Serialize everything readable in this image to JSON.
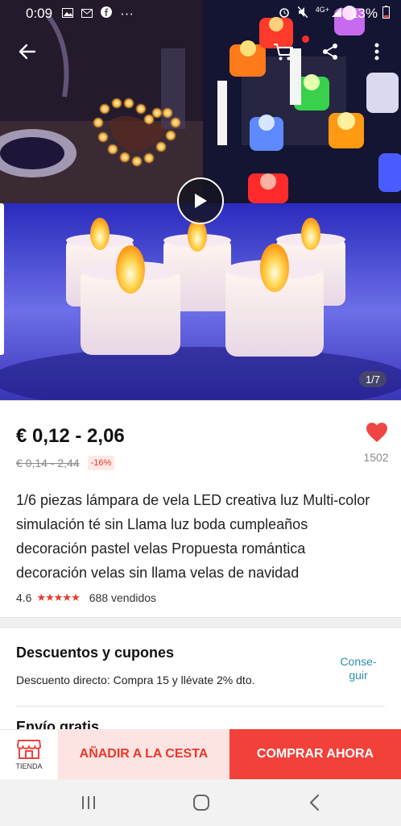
{
  "status_bar": {
    "time": "0:09",
    "notif_icons": [
      "gallery-icon",
      "gmail-icon",
      "facebook-icon"
    ],
    "more_notifs": "···",
    "network": "4G+",
    "battery": "13%"
  },
  "gallery": {
    "counter": "1/7",
    "has_video": true
  },
  "product": {
    "price": "€ 0,12 - 2,06",
    "old_price": "€ 0,14 - 2,44",
    "discount": "-16%",
    "favorites": "1502",
    "title": "1/6 piezas lámpara de vela LED creativa luz Multi-color simulación té sin Llama luz boda cumpleaños decoración pastel velas Propuesta romántica decoración velas sin llama velas de navidad",
    "rating": "4.6",
    "stars_display": "★★★★★",
    "sold": "688 vendidos"
  },
  "discounts": {
    "title": "Descuentos y cupones",
    "text": "Descuento directo: Compra 15 y llévate 2% dto.",
    "link_line1": "Conse-",
    "link_line2": "guir",
    "next_section": "Envío gratis"
  },
  "actions": {
    "store_label": "TIENDA",
    "add_to_cart": "AÑADIR A LA CESTA",
    "buy_now": "COMPRAR AHORA"
  },
  "colors": {
    "accent": "#f2413a",
    "accent_light": "#fde4e2",
    "link": "#2b8fa8",
    "heart": "#f04545"
  }
}
